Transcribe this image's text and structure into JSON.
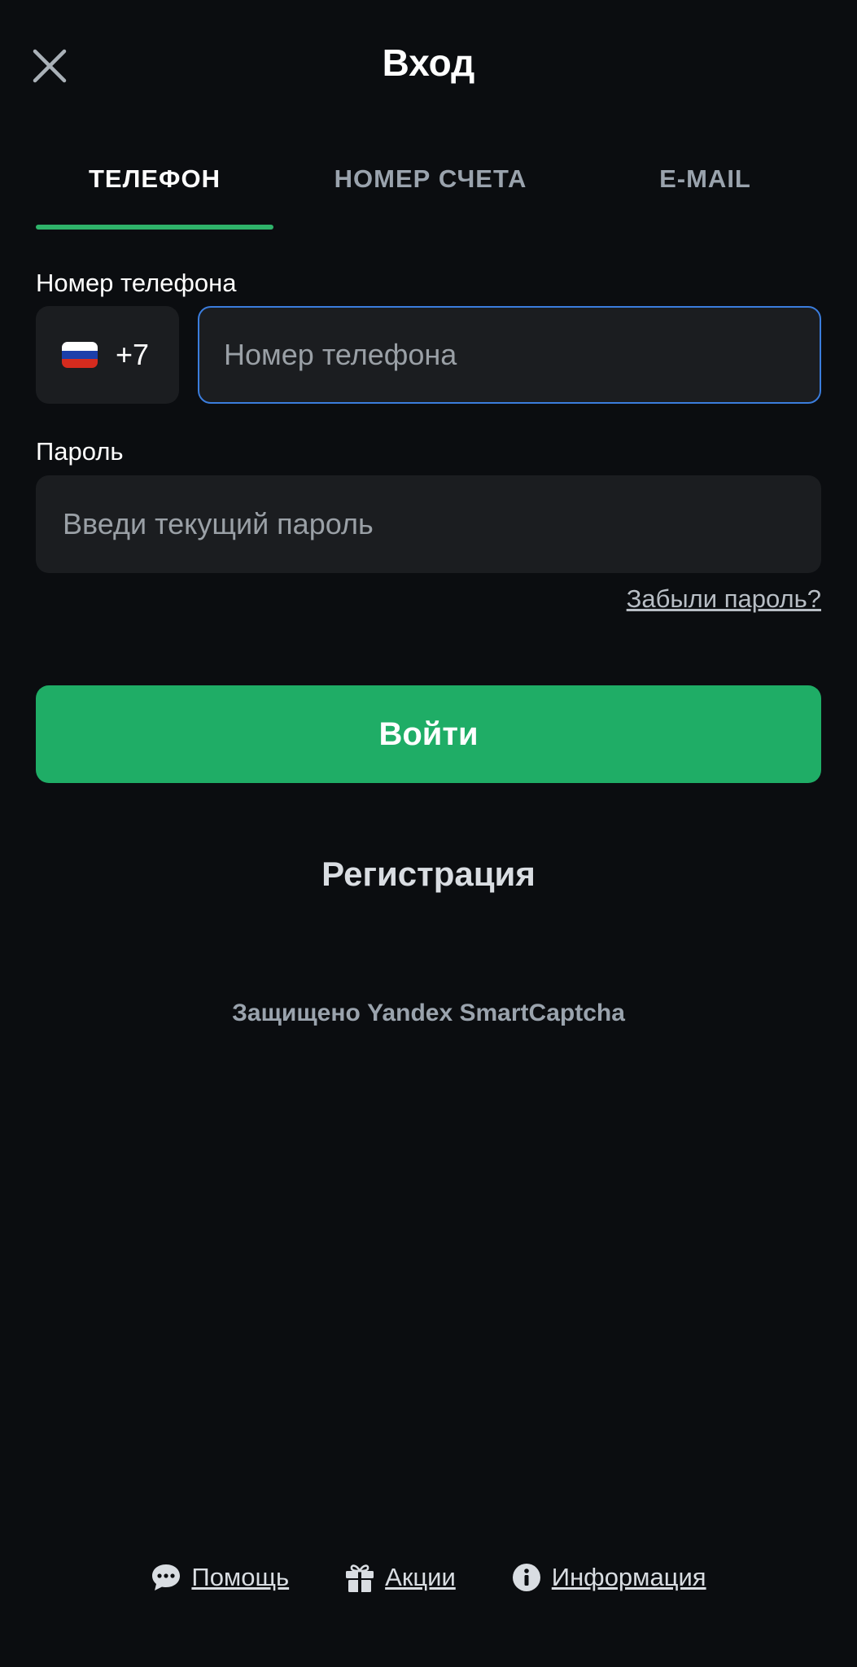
{
  "header": {
    "title": "Вход"
  },
  "tabs": [
    {
      "label": "ТЕЛЕФОН",
      "active": true
    },
    {
      "label": "НОМЕР СЧЕТА",
      "active": false
    },
    {
      "label": "E-MAIL",
      "active": false
    }
  ],
  "phone": {
    "label": "Номер телефона",
    "country_code": "+7",
    "country_flag": "russia-flag-icon",
    "placeholder": "Номер телефона",
    "value": ""
  },
  "password": {
    "label": "Пароль",
    "placeholder": "Введи текущий пароль",
    "value": ""
  },
  "forgot_link": "Забыли пароль?",
  "login_button": "Войти",
  "register_link": "Регистрация",
  "captcha_text": "Защищено Yandex SmartCaptcha",
  "footer": {
    "help": {
      "label": "Помощь",
      "icon": "chat-bubble-icon"
    },
    "promos": {
      "label": "Акции",
      "icon": "gift-icon"
    },
    "info": {
      "label": "Информация",
      "icon": "info-icon"
    }
  },
  "colors": {
    "background": "#0b0d10",
    "field": "#1b1d20",
    "accent_green": "#1fad66",
    "focus_blue": "#3b7ddd",
    "tab_underline": "#2fb36a"
  }
}
